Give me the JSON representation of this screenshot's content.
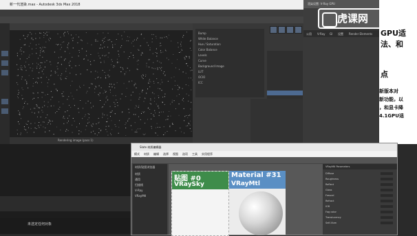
{
  "max": {
    "title": "新一代渲染.max - Autodesk 3ds Max 2018",
    "vfb_status": "Rendering image (pass 1)",
    "channels": [
      "Bump",
      "White Balance",
      "Hue / Saturation",
      "Color Balance",
      "Levels",
      "Curve",
      "Background Image",
      "LUT",
      "OCIO",
      "ICC"
    ],
    "bottom_status": "未选定任何对象"
  },
  "render_settings": {
    "title": "渲染设置: V-Ray GPU",
    "tabs": [
      "公用",
      "V-Ray",
      "GI",
      "设置",
      "Render Elements"
    ]
  },
  "slide": {
    "lines": [
      "GPU适",
      "法、和",
      "点",
      "新版本对",
      "新功能，以",
      "，和显卡降",
      "4.1GPU适"
    ]
  },
  "watermark": {
    "text": "虎课网"
  },
  "slate": {
    "title": "Slate 材质编辑器",
    "menu": [
      "模式",
      "材质",
      "编辑",
      "选择",
      "视图",
      "选项",
      "工具",
      "实用程序"
    ],
    "browser_items": [
      "材质/贴图浏览器",
      "材质",
      "通用",
      "扫描线",
      "V-Ray",
      "VRayMtl"
    ],
    "node_a": {
      "title": "贴图 #0",
      "subtitle": "VRaySky"
    },
    "node_b": {
      "title": "Material #31",
      "subtitle": "VRayMtl"
    },
    "param_header": "VRayMtl Parameters",
    "params": [
      "Diffuse",
      "Roughness",
      "Reflect",
      "Gloss",
      "Fresnel",
      "Refract",
      "IOR",
      "Fog color",
      "Translucency",
      "Self-illum"
    ]
  }
}
